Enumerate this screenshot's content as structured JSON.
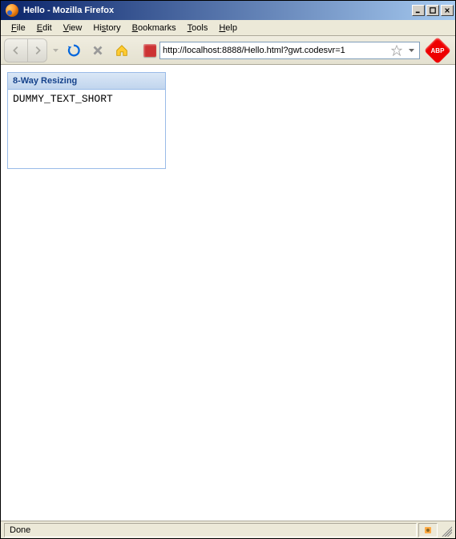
{
  "window": {
    "title": "Hello - Mozilla Firefox"
  },
  "menu": {
    "file": "File",
    "edit": "Edit",
    "view": "View",
    "history": "History",
    "bookmarks": "Bookmarks",
    "tools": "Tools",
    "help": "Help"
  },
  "toolbar": {
    "url": "http://localhost:8888/Hello.html?gwt.codesvr=1"
  },
  "content": {
    "panel_title": "8-Way Resizing",
    "panel_body": "DUMMY_TEXT_SHORT"
  },
  "status": {
    "text": "Done"
  },
  "icons": {
    "abp": "ABP"
  }
}
